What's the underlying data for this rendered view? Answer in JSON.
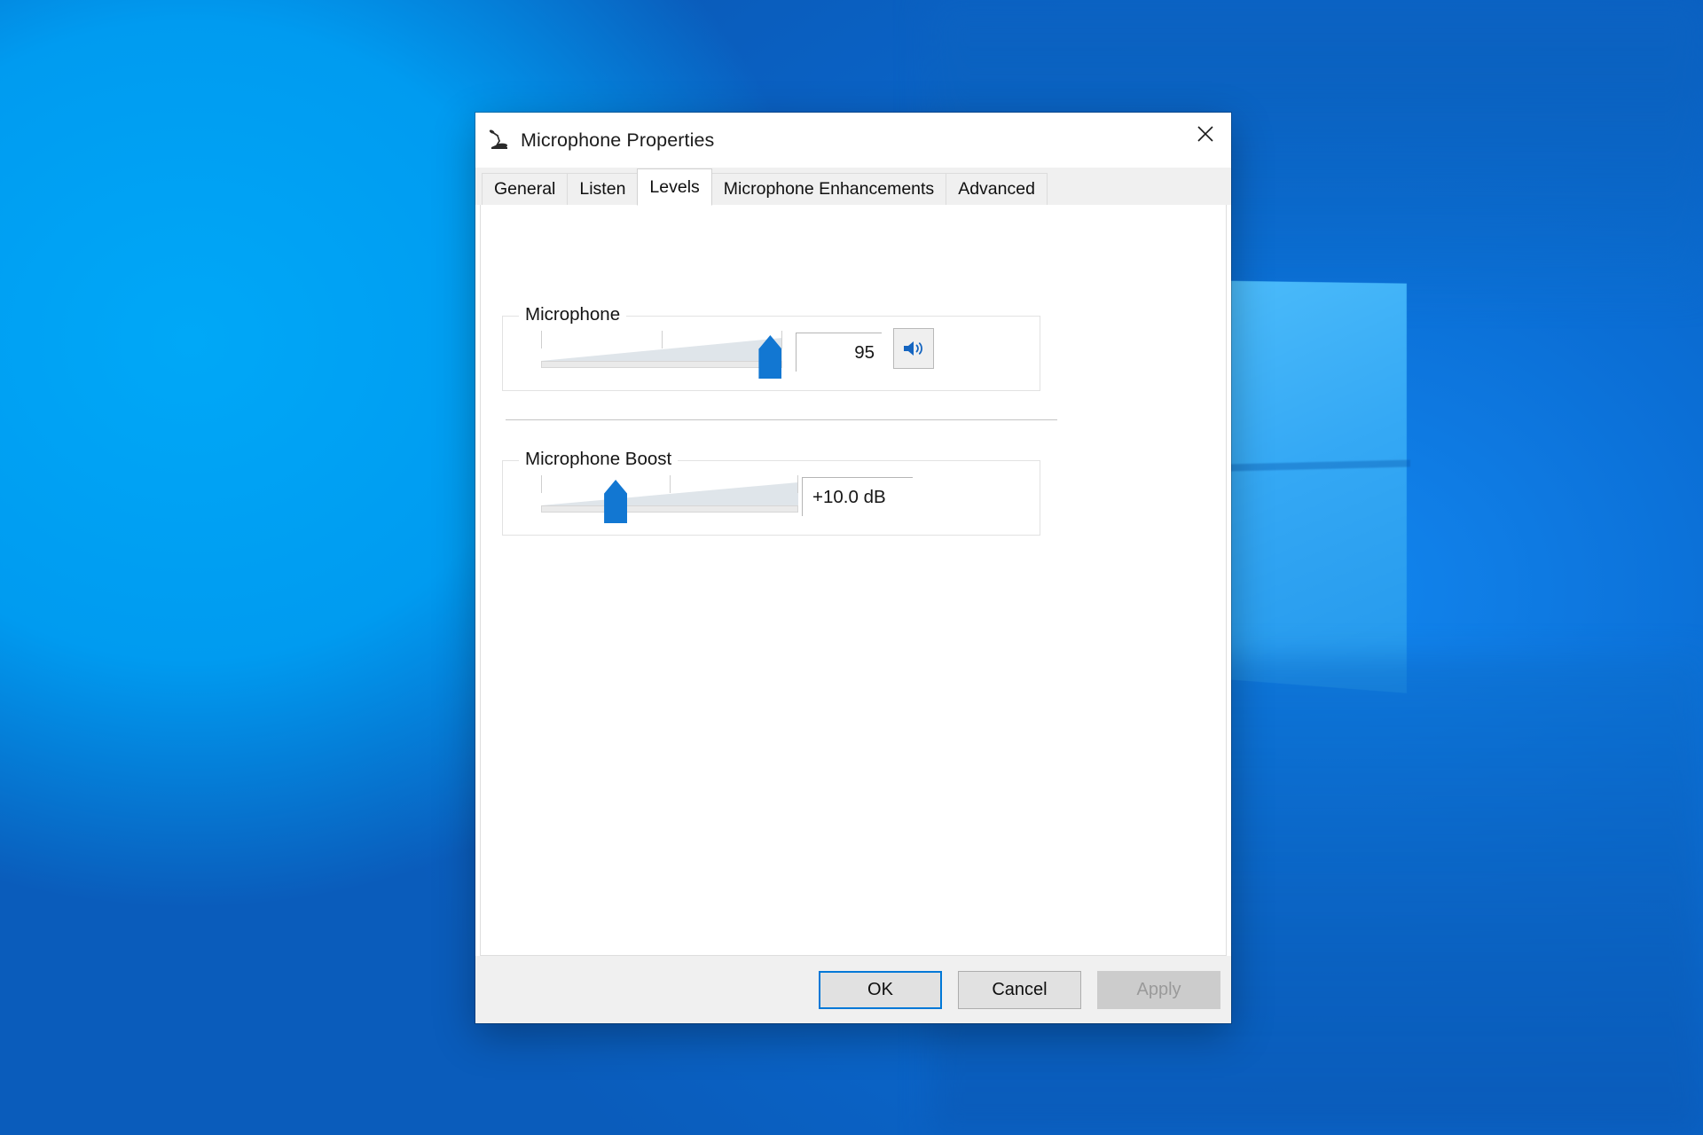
{
  "desktop": {
    "wallpaper_name": "windows-hero-wallpaper",
    "accent_blue": "#0078d7",
    "wallpaper_light_blue": "#00a2f3",
    "wallpaper_deep_blue": "#0a5cbb"
  },
  "dialog": {
    "title": "Microphone Properties",
    "title_icon": "microphone-icon",
    "close_icon": "close-icon",
    "tabs": [
      {
        "label": "General",
        "active": false
      },
      {
        "label": "Listen",
        "active": false
      },
      {
        "label": "Levels",
        "active": true
      },
      {
        "label": "Microphone Enhancements",
        "active": false
      },
      {
        "label": "Advanced",
        "active": false
      }
    ],
    "groups": {
      "microphone": {
        "title": "Microphone",
        "slider_value": 95,
        "slider_min": 0,
        "slider_max": 100,
        "value_text": "95",
        "mute_button_icon": "speaker-volume-icon",
        "mute_state": "unmuted"
      },
      "microphone_boost": {
        "title": "Microphone Boost",
        "slider_value": 10,
        "slider_min": 0,
        "slider_max": 30,
        "slider_percent": 29,
        "value_text": "+10.0 dB"
      }
    },
    "footer": {
      "ok_label": "OK",
      "cancel_label": "Cancel",
      "apply_label": "Apply",
      "apply_disabled": true
    }
  }
}
